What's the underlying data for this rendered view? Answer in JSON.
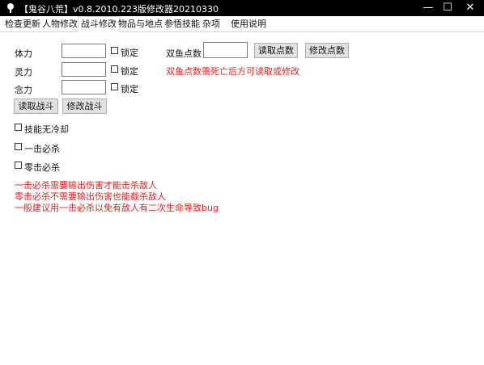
{
  "window": {
    "title": "【鬼谷八荒】v0.8.2010.223版修改器20210330",
    "minimize_glyph": "—",
    "maximize_glyph": "☐",
    "close_glyph": "✕"
  },
  "tabs": [
    {
      "label": "检查更新"
    },
    {
      "label": "人物修改"
    },
    {
      "label": "战斗修改",
      "active": true
    },
    {
      "label": "物品与地点"
    },
    {
      "label": "参悟技能"
    },
    {
      "label": "杂项"
    },
    {
      "label": "使用说明"
    }
  ],
  "battle": {
    "stats": [
      {
        "label": "体力",
        "value": "",
        "lock_label": "锁定"
      },
      {
        "label": "灵力",
        "value": "",
        "lock_label": "锁定"
      },
      {
        "label": "念力",
        "value": "",
        "lock_label": "锁定"
      }
    ],
    "read_button": "读取战斗",
    "modify_button": "修改战斗",
    "options": [
      {
        "label": "技能无冷却"
      },
      {
        "label": "一击必杀"
      },
      {
        "label": "零击必杀"
      }
    ],
    "notes": [
      "一击必杀需要输出伤害才能击杀敌人",
      "零击必杀不需要输出伤害也能截杀敌人",
      "一般建议用一击必杀以免有敌人有二次生命导致bug"
    ]
  },
  "fish_points": {
    "label": "双鱼点数",
    "value": "",
    "read_button": "读取点数",
    "modify_button": "修改点数",
    "note": "双鱼点数需死亡后方可读取或修改"
  },
  "colors": {
    "titlebar_bg": "#000000",
    "note_red": "#e32222",
    "button_bg": "#e1e1e1"
  }
}
